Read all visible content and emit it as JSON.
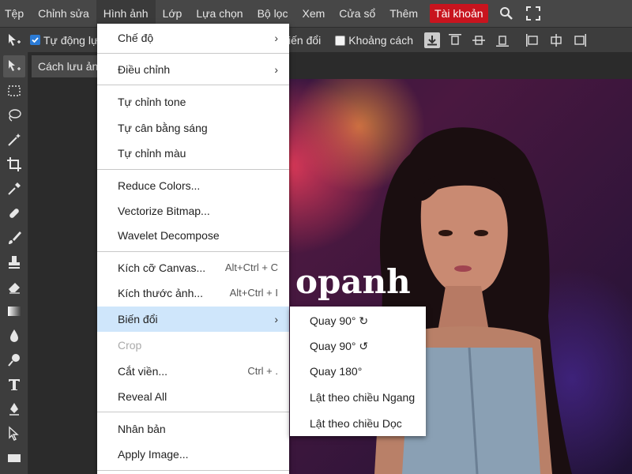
{
  "menubar": {
    "items": [
      "Tệp",
      "Chỉnh sửa",
      "Hình ảnh",
      "Lớp",
      "Lựa chọn",
      "Bộ lọc",
      "Xem",
      "Cửa sổ",
      "Thêm"
    ],
    "account": "Tài khoản",
    "account_color": "#c8141e"
  },
  "options": {
    "auto_select_label": "Tự động lựa",
    "transform_label": "iến đổi",
    "distance_label": "Khoảng cách"
  },
  "document": {
    "tab_label": "Cách lưu ảnh",
    "canvas_text": "opanh"
  },
  "dropdown": {
    "items": [
      {
        "label": "Chế độ",
        "shortcut": "",
        "arrow": "›"
      },
      {
        "label": "Điều chỉnh",
        "shortcut": "",
        "arrow": "›"
      },
      {
        "label": "Tự chỉnh tone",
        "shortcut": "",
        "arrow": ""
      },
      {
        "label": "Tự cân bằng sáng",
        "shortcut": "",
        "arrow": ""
      },
      {
        "label": "Tự chỉnh màu",
        "shortcut": "",
        "arrow": ""
      },
      {
        "label": "Reduce Colors...",
        "shortcut": "",
        "arrow": ""
      },
      {
        "label": "Vectorize Bitmap...",
        "shortcut": "",
        "arrow": ""
      },
      {
        "label": "Wavelet Decompose",
        "shortcut": "",
        "arrow": ""
      },
      {
        "label": "Kích cỡ Canvas...",
        "shortcut": "Alt+Ctrl + C",
        "arrow": ""
      },
      {
        "label": "Kích thước ảnh...",
        "shortcut": "Alt+Ctrl + I",
        "arrow": ""
      },
      {
        "label": "Biến đổi",
        "shortcut": "",
        "arrow": "›"
      },
      {
        "label": "Crop",
        "shortcut": "",
        "arrow": ""
      },
      {
        "label": "Cắt viền...",
        "shortcut": "Ctrl + .",
        "arrow": ""
      },
      {
        "label": "Reveal All",
        "shortcut": "",
        "arrow": ""
      },
      {
        "label": "Nhân bản",
        "shortcut": "",
        "arrow": ""
      },
      {
        "label": "Apply Image...",
        "shortcut": "",
        "arrow": ""
      }
    ]
  },
  "submenu": {
    "items": [
      "Quay 90° ↻",
      "Quay 90° ↺",
      "Quay 180°",
      "Lật theo chiều Ngang",
      "Lật theo chiều Dọc"
    ]
  }
}
